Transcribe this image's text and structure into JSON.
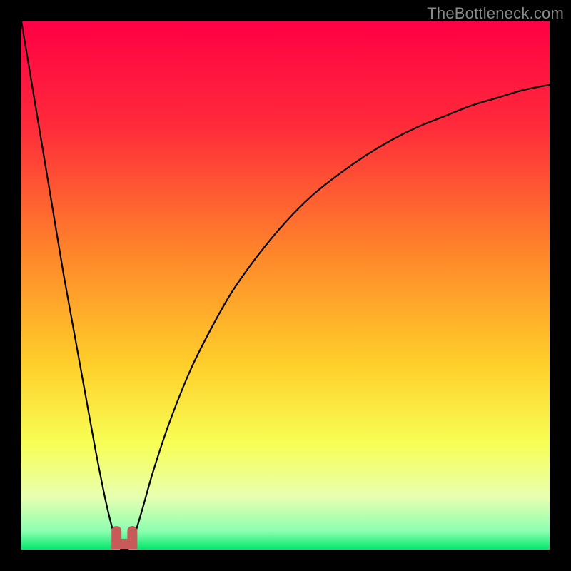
{
  "watermark": "TheBottleneck.com",
  "chart_data": {
    "type": "line",
    "title": "",
    "xlabel": "",
    "ylabel": "",
    "xlim": [
      0,
      100
    ],
    "ylim": [
      0,
      100
    ],
    "grid": false,
    "series": [
      {
        "name": "bottleneck-curve",
        "x": [
          0,
          2,
          4,
          6,
          8,
          10,
          12,
          14,
          16,
          17.5,
          18.5,
          19.5,
          20.5,
          21.5,
          23,
          25,
          28,
          32,
          36,
          40,
          45,
          50,
          55,
          60,
          65,
          70,
          75,
          80,
          85,
          90,
          95,
          100
        ],
        "values": [
          100,
          88,
          76,
          64,
          52,
          41,
          30,
          19,
          9,
          3,
          0.5,
          0,
          0.5,
          3,
          8,
          15,
          24,
          34,
          42,
          49,
          56,
          62,
          67,
          71,
          74.5,
          77.5,
          80,
          82,
          84,
          85.5,
          87,
          88
        ]
      },
      {
        "name": "safe-zone-marker",
        "x": [
          18,
          21
        ],
        "values": [
          0,
          0
        ]
      }
    ],
    "gradient_stops": [
      {
        "pos": 0.0,
        "color": "#ff0044"
      },
      {
        "pos": 0.2,
        "color": "#ff2b3a"
      },
      {
        "pos": 0.45,
        "color": "#ff8a2a"
      },
      {
        "pos": 0.65,
        "color": "#ffcf2a"
      },
      {
        "pos": 0.8,
        "color": "#f7ff55"
      },
      {
        "pos": 0.9,
        "color": "#e8ffb0"
      },
      {
        "pos": 0.965,
        "color": "#8cffb0"
      },
      {
        "pos": 1.0,
        "color": "#00e86a"
      }
    ],
    "marker_color": "#c85a5a"
  }
}
